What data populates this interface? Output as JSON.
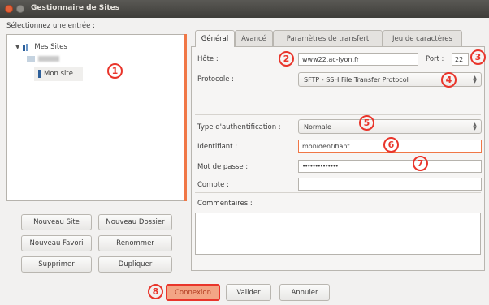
{
  "window": {
    "title": "Gestionnaire de Sites"
  },
  "left": {
    "select_label": "Sélectionnez une entrée :",
    "tree": {
      "root": "Mes Sites",
      "selected": "Mon site"
    },
    "buttons": {
      "new_site": "Nouveau Site",
      "new_folder": "Nouveau Dossier",
      "new_favorite": "Nouveau Favori",
      "rename": "Renommer",
      "delete": "Supprimer",
      "duplicate": "Dupliquer"
    }
  },
  "tabs": [
    "Général",
    "Avancé",
    "Paramètres de transfert",
    "Jeu de caractères"
  ],
  "form": {
    "host_label": "Hôte :",
    "host_value": "www22.ac-lyon.fr",
    "port_label": "Port :",
    "port_value": "22",
    "protocol_label": "Protocole :",
    "protocol_value": "SFTP - SSH File Transfer Protocol",
    "auth_label": "Type d'authentification :",
    "auth_value": "Normale",
    "user_label": "Identifiant :",
    "user_value": "monidentifiant",
    "password_label": "Mot de passe :",
    "password_value": "••••••••••••••",
    "account_label": "Compte :",
    "account_value": "",
    "comments_label": "Commentaires :"
  },
  "bottom_buttons": {
    "connect": "Connexion",
    "validate": "Valider",
    "cancel": "Annuler"
  },
  "annotations": [
    "1",
    "2",
    "3",
    "4",
    "5",
    "6",
    "7",
    "8"
  ],
  "colors": {
    "annotation": "#e9352b",
    "accent": "#f07746",
    "titlebar": "#3e3d39"
  }
}
